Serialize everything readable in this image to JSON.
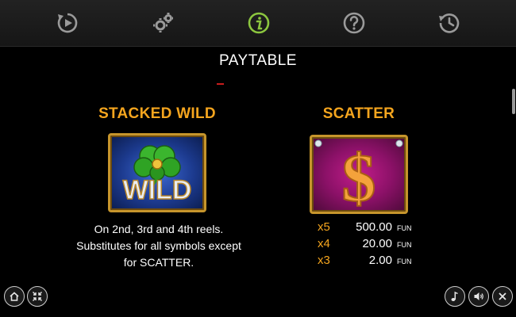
{
  "toolbar": {
    "items": [
      {
        "icon": "replay-icon",
        "active": false
      },
      {
        "icon": "settings-icon",
        "active": false
      },
      {
        "icon": "info-icon",
        "active": true
      },
      {
        "icon": "help-icon",
        "active": false
      },
      {
        "icon": "history-icon",
        "active": false
      }
    ],
    "active_color": "#8cc63f",
    "inactive_color": "#9a9a9a"
  },
  "page": {
    "title": "PAYTABLE"
  },
  "stacked_wild": {
    "title": "STACKED WILD",
    "symbol_text": "WILD",
    "description": [
      "On 2nd, 3rd and 4th reels.",
      "Substitutes for all symbols except",
      "for SCATTER."
    ]
  },
  "scatter": {
    "title": "SCATTER",
    "symbol_glyph": "$",
    "payouts": [
      {
        "multiplier": "x5",
        "value": "500.00",
        "currency": "FUN"
      },
      {
        "multiplier": "x4",
        "value": "20.00",
        "currency": "FUN"
      },
      {
        "multiplier": "x3",
        "value": "2.00",
        "currency": "FUN"
      }
    ]
  },
  "bottom_left": [
    {
      "icon": "home-icon"
    },
    {
      "icon": "fullscreen-icon"
    }
  ],
  "bottom_right": [
    {
      "icon": "music-icon"
    },
    {
      "icon": "sound-icon"
    },
    {
      "icon": "close-icon"
    }
  ],
  "colors": {
    "accent": "#f5a51e",
    "background": "#000000",
    "tile_border": "#c6952c"
  }
}
